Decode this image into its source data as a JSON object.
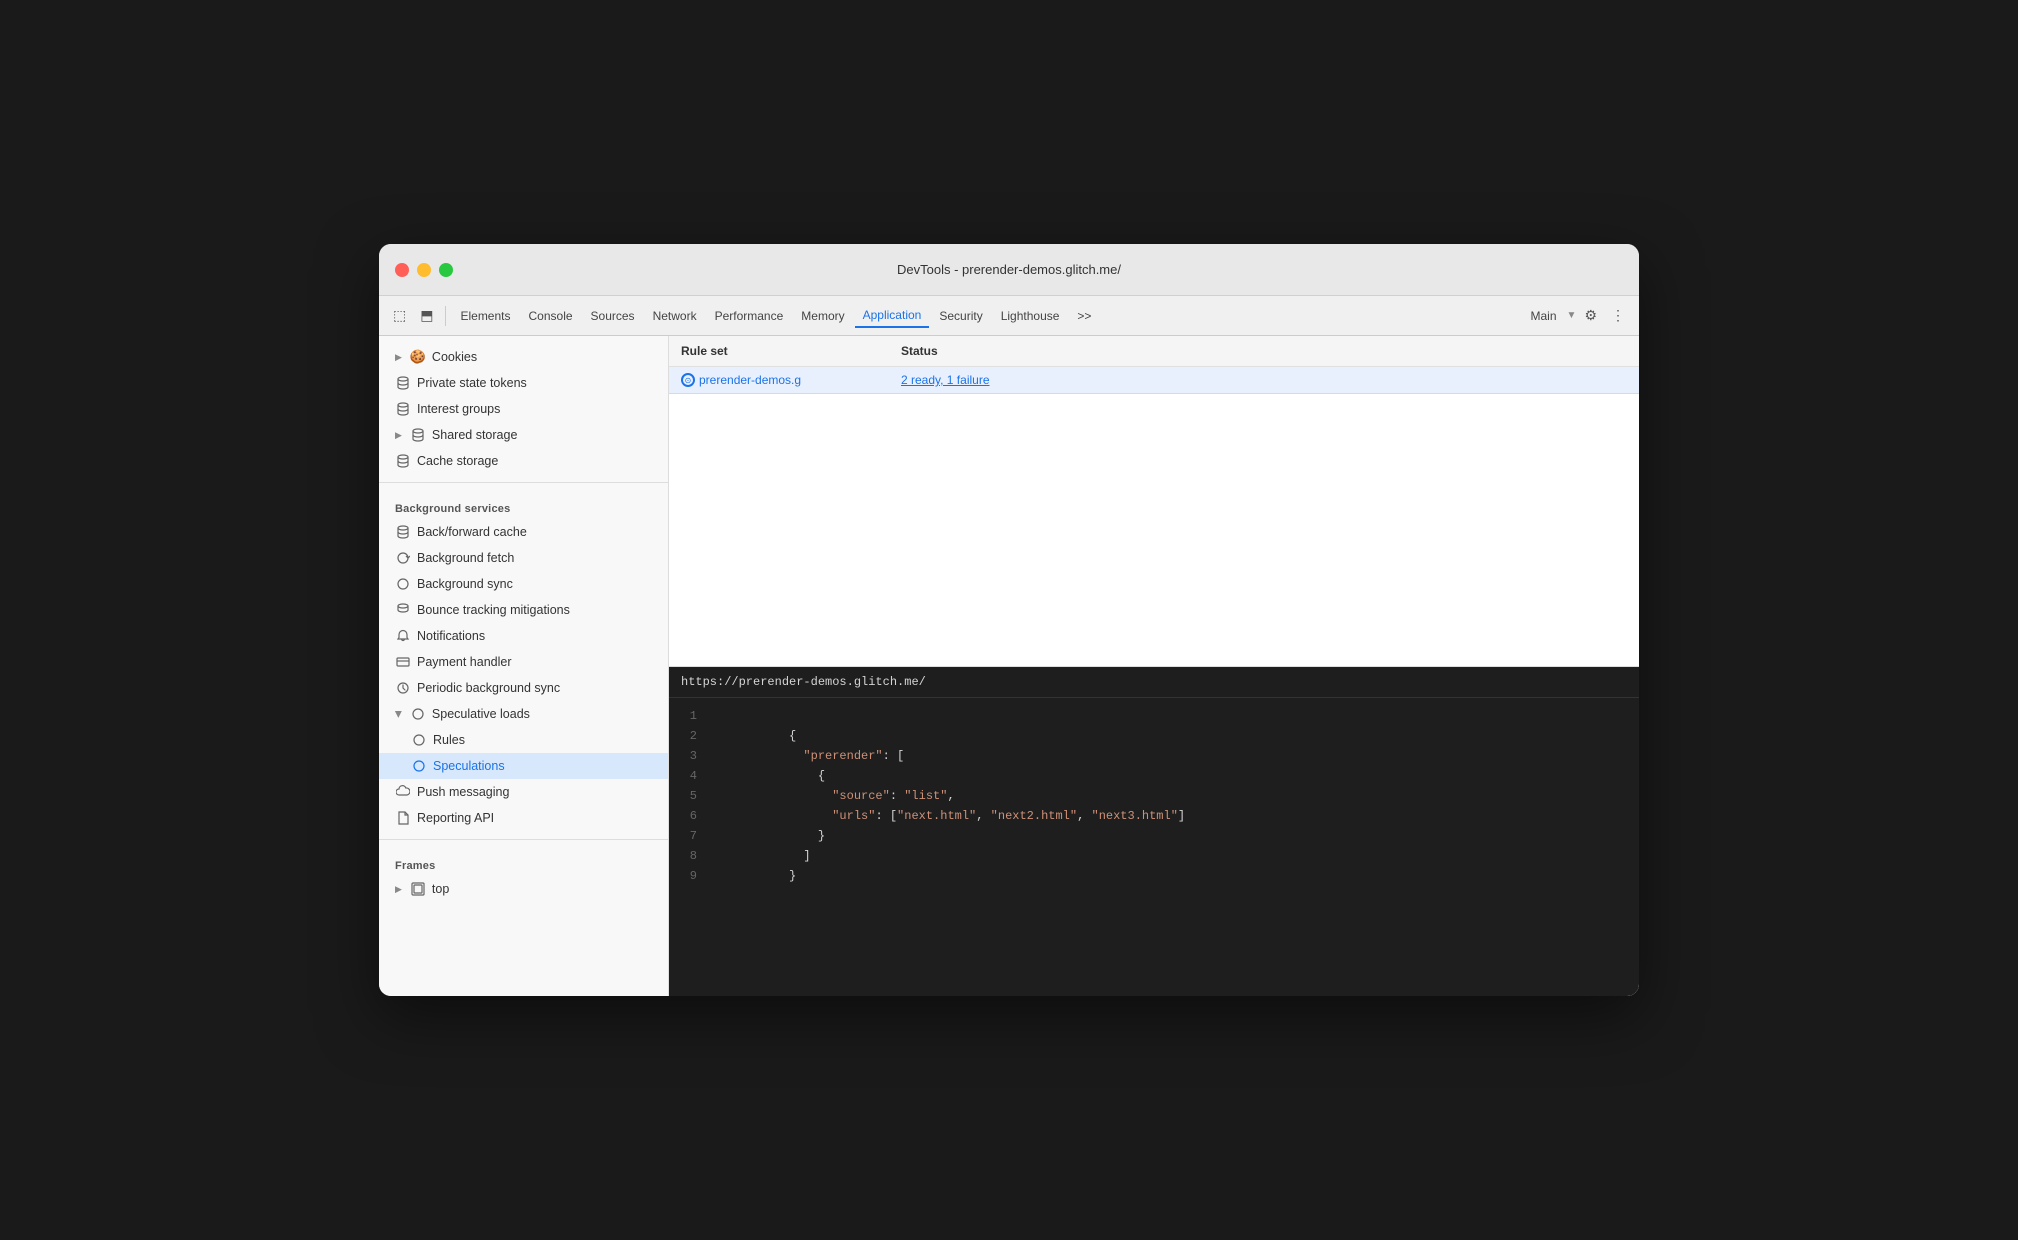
{
  "window": {
    "title": "DevTools - prerender-demos.glitch.me/"
  },
  "toolbar": {
    "buttons": [
      {
        "label": "Elements",
        "active": false
      },
      {
        "label": "Console",
        "active": false
      },
      {
        "label": "Sources",
        "active": false
      },
      {
        "label": "Network",
        "active": false
      },
      {
        "label": "Performance",
        "active": false
      },
      {
        "label": "Memory",
        "active": false
      },
      {
        "label": "Application",
        "active": true
      },
      {
        "label": "Security",
        "active": false
      },
      {
        "label": "Lighthouse",
        "active": false
      }
    ],
    "more_label": ">>",
    "main_label": "Main",
    "settings_icon": "⚙",
    "dots_icon": "⋮"
  },
  "sidebar": {
    "sections": [
      {
        "items": [
          {
            "label": "Cookies",
            "icon": "cookie",
            "hasArrow": true,
            "indent": 0
          },
          {
            "label": "Private state tokens",
            "icon": "db",
            "hasArrow": false,
            "indent": 0
          },
          {
            "label": "Interest groups",
            "icon": "db",
            "hasArrow": false,
            "indent": 0
          },
          {
            "label": "Shared storage",
            "icon": "db",
            "hasArrow": true,
            "indent": 0
          },
          {
            "label": "Cache storage",
            "icon": "db",
            "hasArrow": false,
            "indent": 0
          }
        ]
      }
    ],
    "bg_services_header": "Background services",
    "bg_services": [
      {
        "label": "Back/forward cache",
        "icon": "db"
      },
      {
        "label": "Background fetch",
        "icon": "sync"
      },
      {
        "label": "Background sync",
        "icon": "sync"
      },
      {
        "label": "Bounce tracking mitigations",
        "icon": "db"
      },
      {
        "label": "Notifications",
        "icon": "bell"
      },
      {
        "label": "Payment handler",
        "icon": "card"
      },
      {
        "label": "Periodic background sync",
        "icon": "clock"
      },
      {
        "label": "Speculative loads",
        "icon": "sync",
        "hasArrow": true,
        "expanded": true
      },
      {
        "label": "Rules",
        "icon": "sync",
        "indent": 1,
        "active": false
      },
      {
        "label": "Speculations",
        "icon": "sync",
        "indent": 1,
        "active": false
      },
      {
        "label": "Push messaging",
        "icon": "cloud"
      },
      {
        "label": "Reporting API",
        "icon": "file"
      }
    ],
    "frames_header": "Frames",
    "frames": [
      {
        "label": "top",
        "icon": "frame",
        "hasArrow": true
      }
    ]
  },
  "table": {
    "col_ruleset": "Rule set",
    "col_status": "Status",
    "row": {
      "ruleset": "prerender-demos.g",
      "status": "2 ready, 1 failure",
      "icon": "⊙"
    }
  },
  "code": {
    "url": "https://prerender-demos.glitch.me/",
    "lines": [
      {
        "num": "1",
        "content": ""
      },
      {
        "num": "2",
        "content": "          {"
      },
      {
        "num": "3",
        "content": "            \"prerender\": ["
      },
      {
        "num": "4",
        "content": "              {"
      },
      {
        "num": "5",
        "content": "                \"source\": \"list\","
      },
      {
        "num": "6",
        "content": "                \"urls\": [\"next.html\", \"next2.html\", \"next3.html\"]"
      },
      {
        "num": "7",
        "content": "              }"
      },
      {
        "num": "8",
        "content": "            ]"
      },
      {
        "num": "9",
        "content": "          }"
      }
    ]
  }
}
